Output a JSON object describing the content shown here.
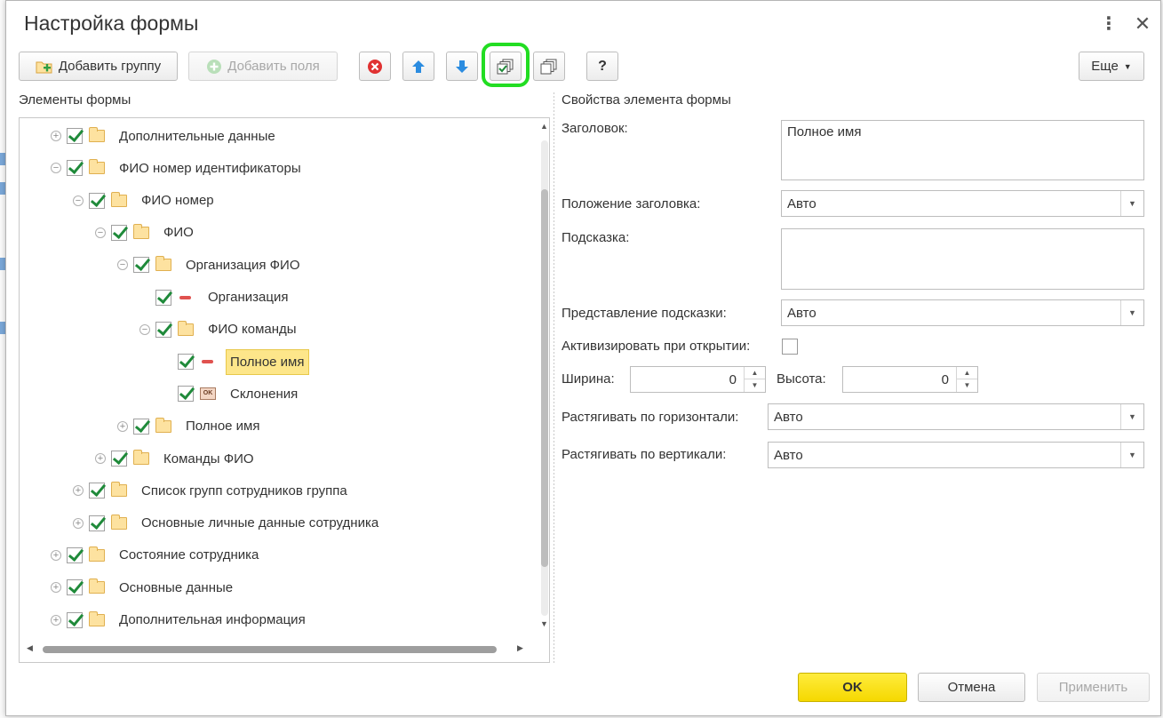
{
  "window": {
    "title": "Настройка формы",
    "more_icon": "more-vertical-icon",
    "close_icon": "close-icon"
  },
  "toolbar": {
    "add_group_label": "Добавить группу",
    "add_fields_label": "Добавить поля",
    "help_label": "?",
    "more_label": "Еще",
    "icons": [
      "delete-icon",
      "move-up-icon",
      "move-down-icon",
      "check-all-icon",
      "uncheck-all-icon"
    ]
  },
  "left_panel": {
    "title": "Элементы формы"
  },
  "tree": {
    "items": [
      {
        "label": "Дополнительные данные",
        "level": 0,
        "expander": "plus",
        "icon": "folder-icon"
      },
      {
        "label": "ФИО номер идентификаторы",
        "level": 0,
        "expander": "minus",
        "icon": "folder-icon"
      },
      {
        "label": "ФИО номер",
        "level": 1,
        "expander": "minus",
        "icon": "folder-icon"
      },
      {
        "label": "ФИО",
        "level": 2,
        "expander": "minus",
        "icon": "folder-icon"
      },
      {
        "label": "Организация ФИО",
        "level": 3,
        "expander": "minus",
        "icon": "folder-icon"
      },
      {
        "label": "Организация",
        "level": 4,
        "expander": "none",
        "icon": "field-icon"
      },
      {
        "label": "ФИО команды",
        "level": 4,
        "expander": "minus",
        "icon": "folder-icon"
      },
      {
        "label": "Полное имя",
        "level": 5,
        "expander": "none",
        "icon": "field-icon",
        "selected": true
      },
      {
        "label": "Склонения",
        "level": 5,
        "expander": "none",
        "icon": "button-icon"
      },
      {
        "label": "Полное имя",
        "level": 3,
        "expander": "plus",
        "icon": "folder-icon"
      },
      {
        "label": "Команды ФИО",
        "level": 2,
        "expander": "plus",
        "icon": "folder-icon"
      },
      {
        "label": "Список групп сотрудников группа",
        "level": 1,
        "expander": "plus",
        "icon": "folder-icon"
      },
      {
        "label": "Основные личные данные сотрудника",
        "level": 1,
        "expander": "plus",
        "icon": "folder-icon"
      },
      {
        "label": "Состояние сотрудника",
        "level": 0,
        "expander": "plus",
        "icon": "folder-icon"
      },
      {
        "label": "Основные данные",
        "level": 0,
        "expander": "plus",
        "icon": "folder-icon"
      },
      {
        "label": "Дополнительная информация",
        "level": 0,
        "expander": "plus",
        "icon": "folder-icon"
      }
    ],
    "button_icon_text": "OK"
  },
  "properties": {
    "title": "Свойства элемента формы",
    "header_label": "Заголовок:",
    "header_value": "Полное имя",
    "header_position_label": "Положение заголовка:",
    "header_position_value": "Авто",
    "tooltip_label": "Подсказка:",
    "tooltip_value": "",
    "tooltip_display_label": "Представление подсказки:",
    "tooltip_display_value": "Авто",
    "activate_label": "Активизировать при открытии:",
    "activate_checked": false,
    "width_label": "Ширина:",
    "width_value": "0",
    "height_label": "Высота:",
    "height_value": "0",
    "stretch_h_label": "Растягивать по горизонтали:",
    "stretch_h_value": "Авто",
    "stretch_v_label": "Растягивать по вертикали:",
    "stretch_v_value": "Авто"
  },
  "footer": {
    "ok_label": "OK",
    "cancel_label": "Отмена",
    "apply_label": "Применить"
  },
  "colors": {
    "accent_ok": "#f5d800",
    "selection": "#fde68a",
    "highlight_ring": "#22dd22",
    "checkmark": "#1f8a3a"
  }
}
